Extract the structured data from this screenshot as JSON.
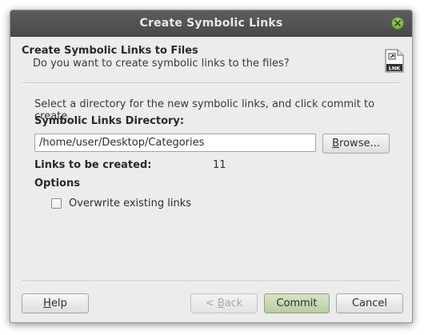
{
  "window": {
    "title": "Create Symbolic Links"
  },
  "header": {
    "title": "Create Symbolic Links to Files",
    "subtitle": "Do you want to create symbolic links to the files?",
    "icon": "lnk-file-icon",
    "icon_text": "LNK"
  },
  "form": {
    "instruction": "Select a directory for the new symbolic links, and click commit to create.",
    "directory_label": "Symbolic Links Directory:",
    "directory_value": "/home/user/Desktop/Categories",
    "browse_label_mnemonic": "B",
    "browse_label_rest": "rowse...",
    "links_label": "Links to be created:",
    "links_count": "11",
    "options_label": "Options",
    "overwrite_label": "Overwrite existing links",
    "overwrite_checked": false
  },
  "buttons": {
    "help_mnemonic": "H",
    "help_rest": "elp",
    "back_prefix": "< ",
    "back_mnemonic": "B",
    "back_rest": "ack",
    "commit": "Commit",
    "cancel": "Cancel"
  },
  "colors": {
    "titlebar": "#4f4f4f",
    "close_button": "#7ebc4d",
    "commit_button": "#c6d7b2",
    "window_bg": "#ececec"
  }
}
